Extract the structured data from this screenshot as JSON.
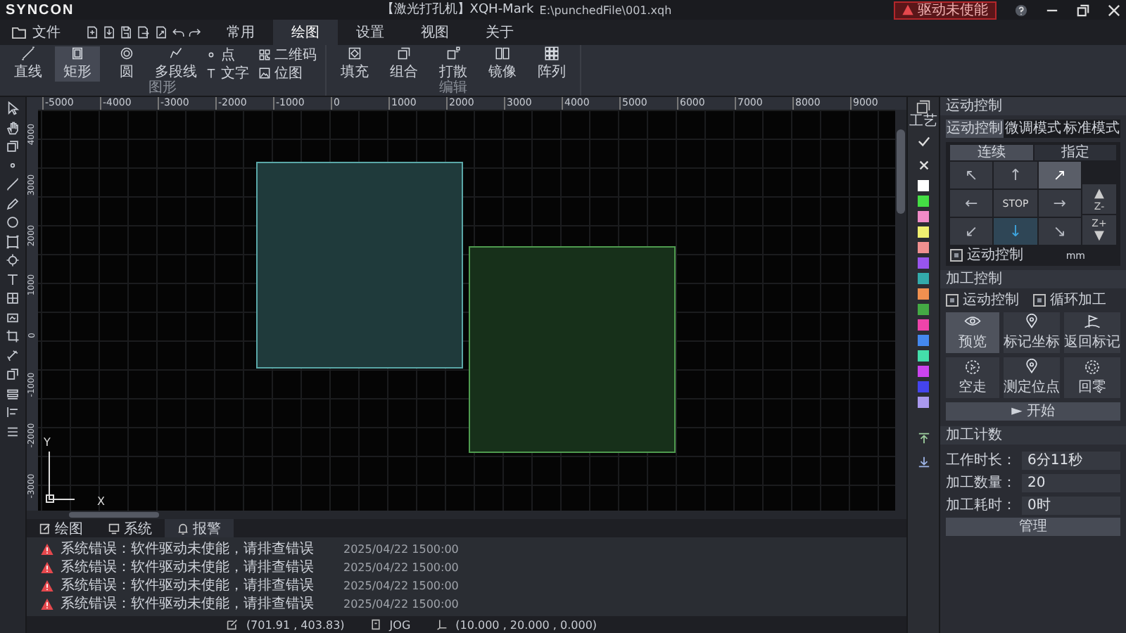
{
  "app": {
    "logo": "SYNCON",
    "title": "【激光打孔机】XQH-Mark",
    "file_path": "E:\\punchedFile\\001.xqh",
    "alert_badge": "驱动未使能"
  },
  "file_menu": "文件",
  "ribbon_tabs": [
    {
      "label": "常用",
      "selected": false
    },
    {
      "label": "绘图",
      "selected": true
    },
    {
      "label": "设置",
      "selected": false
    },
    {
      "label": "视图",
      "selected": false
    },
    {
      "label": "关于",
      "selected": false
    }
  ],
  "ribbon_groups": [
    {
      "label": "图形",
      "columns": [
        [
          {
            "label": "直线",
            "kind": "line",
            "selected": false
          }
        ],
        [
          {
            "label": "矩形",
            "kind": "rect",
            "selected": true
          }
        ],
        [
          {
            "label": "圆",
            "kind": "circle",
            "selected": false
          }
        ],
        [
          {
            "label": "多段线",
            "kind": "polyline",
            "selected": false
          }
        ],
        [
          {
            "label": "点",
            "kind": "point",
            "selected": false
          },
          {
            "label": "文字",
            "kind": "text",
            "selected": false
          }
        ],
        [
          {
            "label": "二维码",
            "kind": "qrcode",
            "selected": false
          },
          {
            "label": "位图",
            "kind": "bitmap",
            "selected": false
          }
        ]
      ]
    },
    {
      "label": "编辑",
      "columns": [
        [
          {
            "label": "填充",
            "kind": "fill",
            "selected": false
          }
        ],
        [
          {
            "label": "组合",
            "kind": "group",
            "selected": false
          }
        ],
        [
          {
            "label": "打散",
            "kind": "explode",
            "selected": false
          }
        ],
        [
          {
            "label": "镜像",
            "kind": "mirror",
            "selected": false
          }
        ],
        [
          {
            "label": "阵列",
            "kind": "array",
            "selected": false
          }
        ]
      ]
    }
  ],
  "ruler": {
    "x_labels": [
      "-5000",
      "-4000",
      "-3000",
      "-2000",
      "-1000",
      "0",
      "1000",
      "2000",
      "3000",
      "4000",
      "5000",
      "6000",
      "7000",
      "8000",
      "9000"
    ],
    "y_labels": [
      "4000",
      "3000",
      "2000",
      "1000",
      "0",
      "-1000",
      "-2000",
      "-3000"
    ]
  },
  "axis": {
    "y": "Y",
    "x": "X"
  },
  "bottom_tabs": [
    {
      "label": "绘图",
      "kind": "draw",
      "selected": false
    },
    {
      "label": "系统",
      "kind": "system",
      "selected": false
    },
    {
      "label": "报警",
      "kind": "alarm",
      "selected": true
    }
  ],
  "messages": [
    {
      "text": "系统错误：软件驱动未使能，请排查错误",
      "time": "2025/04/22 1500:00"
    },
    {
      "text": "系统错误：软件驱动未使能，请排查错误",
      "time": "2025/04/22 1500:00"
    },
    {
      "text": "系统错误：软件驱动未使能，请排查错误",
      "time": "2025/04/22 1500:00"
    },
    {
      "text": "系统错误：软件驱动未使能，请排查错误",
      "time": "2025/04/22 1500:00"
    }
  ],
  "status": {
    "cursor": "(701.91 , 403.83)",
    "mode": "JOG",
    "position": "(10.000 , 20.000 , 0.000)"
  },
  "layer_strip": {
    "label": "工艺",
    "swatches": [
      {
        "color": "#ffffff"
      },
      {
        "color": "#44dd44"
      },
      {
        "color": "#f08cc8"
      },
      {
        "color": "#f0f070"
      },
      {
        "color": "#f09090"
      },
      {
        "color": "#9955ee"
      },
      {
        "color": "#33aaaa"
      },
      {
        "color": "#f09050"
      },
      {
        "color": "#44aa44"
      },
      {
        "color": "#ee44aa"
      },
      {
        "color": "#4488ee"
      },
      {
        "color": "#44ddaa"
      },
      {
        "color": "#cc44ee"
      },
      {
        "color": "#4444ee"
      },
      {
        "color": "#aa99ee"
      }
    ]
  },
  "motion": {
    "title": "运动控制",
    "tabs": [
      {
        "label": "运动控制",
        "selected": true
      },
      {
        "label": "微调模式",
        "selected": false
      },
      {
        "label": "标准模式",
        "selected": false
      }
    ],
    "jog_tabs": [
      {
        "label": "连续",
        "selected": true
      },
      {
        "label": "指定",
        "selected": false
      }
    ],
    "jog_buttons": [
      {
        "label": "↖",
        "kind": "arrow",
        "selected": false,
        "highlighted": false
      },
      {
        "label": "↑",
        "kind": "arrow",
        "selected": false,
        "highlighted": false
      },
      {
        "label": "↗",
        "kind": "arrow",
        "selected": false,
        "highlighted": true
      },
      {
        "label": "←",
        "kind": "arrow",
        "selected": false,
        "highlighted": false
      },
      {
        "label": "STOP",
        "kind": "stop",
        "selected": false,
        "highlighted": false
      },
      {
        "label": "→",
        "kind": "arrow",
        "selected": false,
        "highlighted": false
      },
      {
        "label": "↙",
        "kind": "arrow",
        "selected": false,
        "highlighted": false
      },
      {
        "label": "↓",
        "kind": "arrow",
        "selected": true,
        "highlighted": false
      },
      {
        "label": "↘",
        "kind": "arrow",
        "selected": false,
        "highlighted": false
      }
    ],
    "z_buttons": [
      {
        "arrow": "▲",
        "label": "Z-",
        "kind": "up"
      },
      {
        "arrow": "▼",
        "label": "Z+",
        "kind": "down"
      }
    ],
    "checkbox": {
      "label": "运动控制",
      "checked": true
    },
    "unit": "mm"
  },
  "process": {
    "title": "加工控制",
    "options": [
      {
        "label": "运动控制",
        "checked": true
      },
      {
        "label": "循环加工",
        "checked": true
      }
    ],
    "actions": [
      {
        "label": "预览",
        "kind": "eye",
        "selected": true
      },
      {
        "label": "标记坐标",
        "kind": "pin",
        "selected": false
      },
      {
        "label": "返回标记",
        "kind": "flag",
        "selected": false
      },
      {
        "label": "空走",
        "kind": "target",
        "selected": false
      },
      {
        "label": "测定位点",
        "kind": "pin",
        "selected": false
      },
      {
        "label": "回零",
        "kind": "ring",
        "selected": false
      }
    ],
    "start_button": "► 开始"
  },
  "counter": {
    "title": "加工计数",
    "fields": [
      {
        "label": "工作时长：",
        "value": "6分11秒"
      },
      {
        "label": "加工数量：",
        "value": "20"
      },
      {
        "label": "加工耗时：",
        "value": "0时"
      }
    ],
    "button": "管理"
  }
}
